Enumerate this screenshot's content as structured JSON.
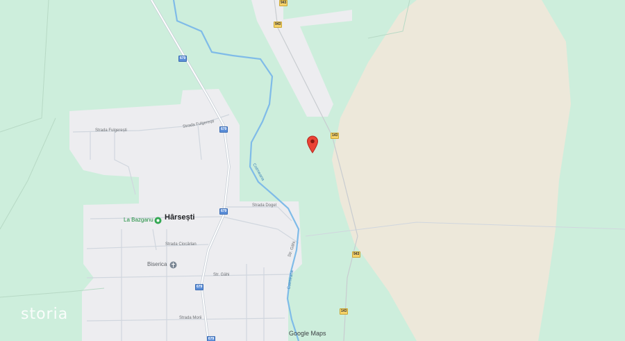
{
  "map": {
    "place_name": "Hârsești",
    "pois": {
      "la_bazganu": "La Bazganu ...",
      "biserica": "Biserica"
    },
    "streets": {
      "strada_fulgeresti_1": "Strada Fulgerești",
      "strada_fulgeresti_2": "Strada Fulgerești",
      "strada_dogel": "Strada Dogel",
      "strada_ciocarlan": "Strada Ciocârlan",
      "str_gahi_1": "Str. Gâhi",
      "str_gahi_2": "Str. Gâhi",
      "strada_morii": "Strada Morii"
    },
    "river_name": "Cotmeana",
    "road_numbers": {
      "r943_top": "943",
      "r943_mid": "943",
      "r943_low": "943",
      "r679_a": "679",
      "r679_b": "679",
      "r679_c": "679",
      "r679_d": "679",
      "r679_e": "679",
      "r143_a": "143",
      "r143_b": "143"
    },
    "watermark": "storia",
    "attribution": "Google Maps",
    "icons": [
      "map-pin-icon",
      "park-poi-icon",
      "church-poi-icon"
    ],
    "colors": {
      "land": "#cdeedc",
      "settlement": "#ededf0",
      "field": "#ede8da",
      "river": "#7fbbe8",
      "pin": "#ea4335"
    }
  }
}
